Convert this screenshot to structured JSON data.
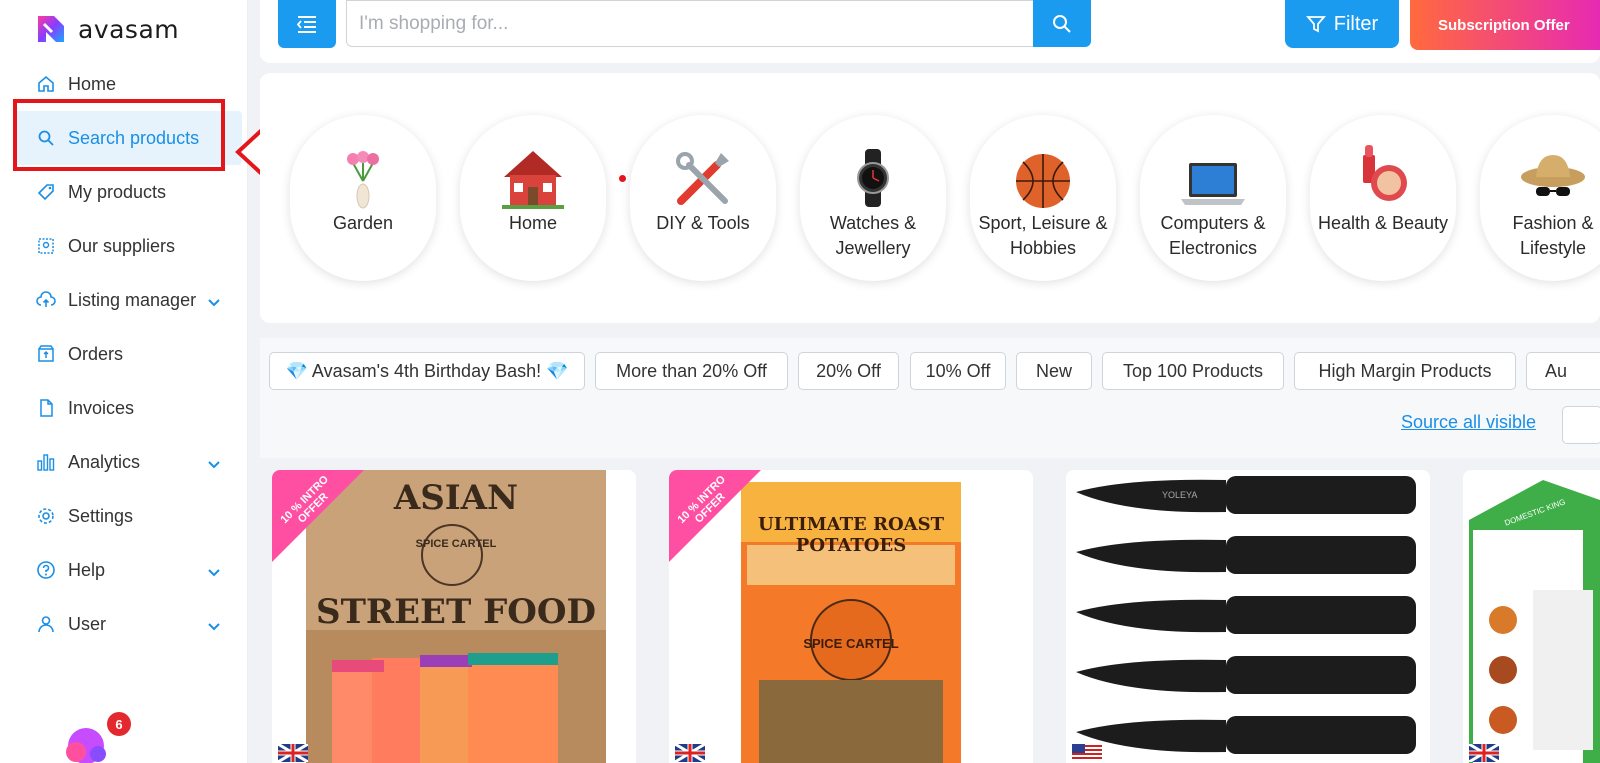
{
  "brand": {
    "name": "avasam"
  },
  "sidebar": {
    "items": [
      {
        "label": "Home",
        "icon": "home-icon"
      },
      {
        "label": "Search products",
        "icon": "search-icon",
        "active": true
      },
      {
        "label": "My products",
        "icon": "tag-icon"
      },
      {
        "label": "Our suppliers",
        "icon": "suppliers-icon"
      },
      {
        "label": "Listing manager",
        "icon": "cloud-upload-icon",
        "expandable": true
      },
      {
        "label": "Orders",
        "icon": "orders-box-icon"
      },
      {
        "label": "Invoices",
        "icon": "invoice-icon"
      },
      {
        "label": "Analytics",
        "icon": "bar-chart-icon",
        "expandable": true
      },
      {
        "label": "Settings",
        "icon": "gear-icon"
      },
      {
        "label": "Help",
        "icon": "help-circle-icon",
        "expandable": true
      },
      {
        "label": "User",
        "icon": "user-icon",
        "expandable": true
      }
    ],
    "notifications_count": "6"
  },
  "header": {
    "search_placeholder": "I'm shopping for...",
    "filter_label": "Filter",
    "subscription_label": "Subscription Offer"
  },
  "categories": [
    {
      "name": "Garden",
      "icon": "flower-vase-icon"
    },
    {
      "name": "Home",
      "icon": "house-icon"
    },
    {
      "name": "DIY & Tools",
      "icon": "tools-icon"
    },
    {
      "name": "Watches & Jewellery",
      "icon": "watch-icon"
    },
    {
      "name": "Sport, Leisure & Hobbies",
      "icon": "basketball-icon"
    },
    {
      "name": "Computers & Electronics",
      "icon": "laptop-icon"
    },
    {
      "name": "Health & Beauty",
      "icon": "cosmetics-icon"
    },
    {
      "name": "Fashion & Lifestyle",
      "icon": "hat-sunglasses-icon"
    }
  ],
  "tags": [
    "💎 Avasam's 4th Birthday Bash! 💎",
    "More than 20% Off",
    "20% Off",
    "10% Off",
    "New",
    "Top 100 Products",
    "High Margin Products",
    "Au"
  ],
  "source_all_label": "Source all visible",
  "products": [
    {
      "ribbon": "10 % INTRO OFFER",
      "image_title": "ASIAN",
      "image_subtitle": "STREET FOOD",
      "brand": "SPICE CARTEL",
      "flag": "uk-flag-icon"
    },
    {
      "ribbon": "10 % INTRO OFFER",
      "image_title": "ULTIMATE ROAST POTATOES",
      "brand": "SPICE CARTEL",
      "flag": "uk-flag-icon"
    },
    {
      "ribbon": "",
      "image_title": "YOLEYA",
      "flag": "us-flag-icon"
    },
    {
      "ribbon": "",
      "image_title": "DOMESTIC KING",
      "flag": "uk-flag-icon"
    }
  ],
  "colors": {
    "accent": "#1a9bf0",
    "highlight": "#e3161c",
    "ribbon": "#ff4fa3"
  }
}
